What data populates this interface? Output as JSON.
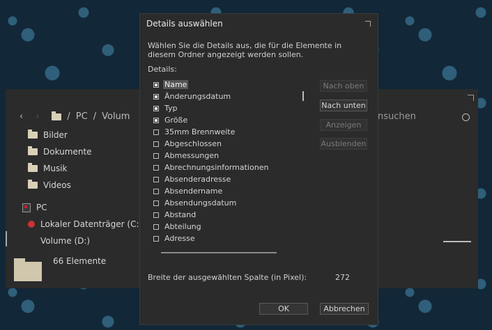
{
  "explorer": {
    "path": [
      "PC",
      "Volum"
    ],
    "search_placeholder": "nsuchen",
    "tree": [
      {
        "label": "Bilder"
      },
      {
        "label": "Dokumente"
      },
      {
        "label": "Musik"
      },
      {
        "label": "Videos"
      }
    ],
    "pc_label": "PC",
    "drives": [
      {
        "label": "Lokaler Datenträger (C:)"
      },
      {
        "label": "Volume (D:)"
      }
    ],
    "status": "66 Elemente"
  },
  "dialog": {
    "title": "Details auswählen",
    "description": "Wählen Sie die Details aus, die für die Elemente in diesem Ordner angezeigt werden sollen.",
    "details_label": "Details:",
    "items": [
      {
        "label": "Name",
        "checked": true,
        "selected": true
      },
      {
        "label": "Änderungsdatum",
        "checked": true
      },
      {
        "label": "Typ",
        "checked": true
      },
      {
        "label": "Größe",
        "checked": true
      },
      {
        "label": "35mm Brennweite",
        "checked": false
      },
      {
        "label": "Abgeschlossen",
        "checked": false
      },
      {
        "label": "Abmessungen",
        "checked": false
      },
      {
        "label": "Abrechnungsinformationen",
        "checked": false
      },
      {
        "label": "Absenderadresse",
        "checked": false
      },
      {
        "label": "Absendername",
        "checked": false
      },
      {
        "label": "Absendungsdatum",
        "checked": false
      },
      {
        "label": "Abstand",
        "checked": false
      },
      {
        "label": "Abteilung",
        "checked": false
      },
      {
        "label": "Adresse",
        "checked": false
      },
      {
        "label": "",
        "checked": false
      }
    ],
    "buttons": {
      "up": "Nach oben",
      "down": "Nach unten",
      "show": "Anzeigen",
      "hide": "Ausblenden"
    },
    "width_label": "Breite der ausgewählten Spalte (in Pixel):",
    "width_value": "272",
    "ok": "OK",
    "cancel": "Abbrechen"
  }
}
